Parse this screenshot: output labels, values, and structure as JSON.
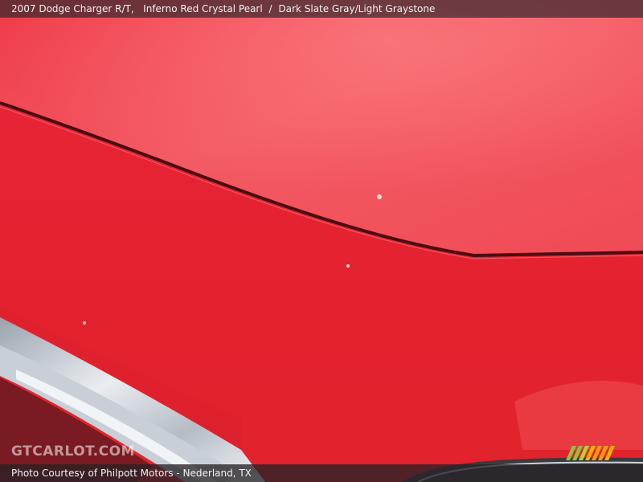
{
  "header": {
    "vehicle": "2007 Dodge Charger R/T,",
    "exterior_color": "Inferno Red Crystal Pearl",
    "separator": "/",
    "interior_color": "Dark Slate Gray/Light Graystone"
  },
  "watermark": {
    "logo_text": "GTCARLOT.COM"
  },
  "footer": {
    "credit": "Photo Courtesy of Philpott Motors - Nederland, TX"
  },
  "colors": {
    "paint": "#e8232f",
    "paint_light": "#f25a63",
    "chrome": "#d9dde3",
    "badge_green": "#8bc53f",
    "badge_orange": "#f39c12"
  }
}
